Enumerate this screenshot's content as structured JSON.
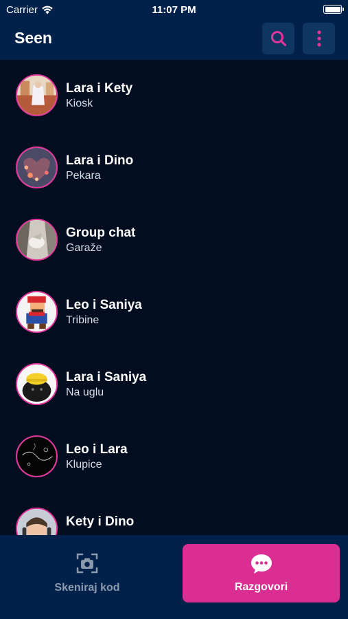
{
  "status_bar": {
    "carrier": "Carrier",
    "time": "11:07 PM"
  },
  "header": {
    "title": "Seen",
    "search_icon": "search-icon",
    "more_icon": "vertical-dots-icon"
  },
  "colors": {
    "accent": "#db2e93",
    "header_bg": "#02214a",
    "list_bg": "#020d1f",
    "icon_button_bg": "#0f3561"
  },
  "chats": [
    {
      "name": "Lara i Kety",
      "location": "Kiosk"
    },
    {
      "name": "Lara i Dino",
      "location": "Pekara"
    },
    {
      "name": "Group chat",
      "location": "Garaže"
    },
    {
      "name": "Leo i Saniya",
      "location": "Tribine"
    },
    {
      "name": "Lara i Saniya",
      "location": "Na uglu"
    },
    {
      "name": "Leo i Lara",
      "location": "Klupice"
    },
    {
      "name": "Kety i Dino",
      "location": ""
    }
  ],
  "bottom_nav": {
    "scan": {
      "label": "Skeniraj kod",
      "icon": "camera-icon"
    },
    "chats": {
      "label": "Razgovori",
      "icon": "chat-bubble-icon"
    }
  }
}
